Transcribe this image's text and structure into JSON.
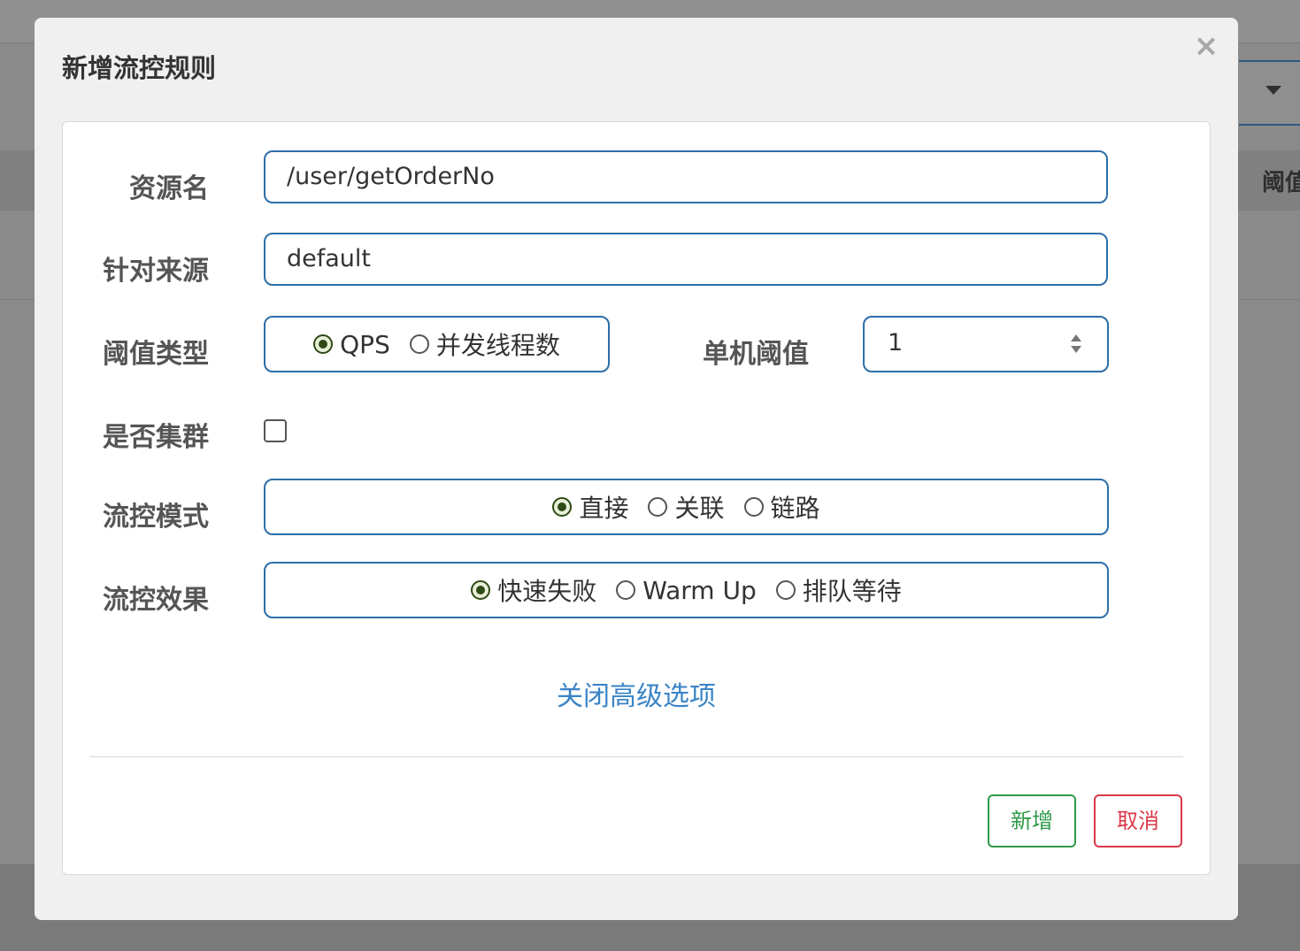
{
  "background": {
    "column_header_partial": "阈值"
  },
  "dialog": {
    "title": "新增流控规则",
    "close_symbol": "×",
    "fields": {
      "resource_label": "资源名",
      "resource_value": "/user/getOrderNo",
      "source_label": "针对来源",
      "source_value": "default",
      "threshold_type_label": "阈值类型",
      "threshold_type_options": [
        "QPS",
        "并发线程数"
      ],
      "threshold_type_selected": "QPS",
      "single_threshold_label": "单机阈值",
      "single_threshold_value": "1",
      "cluster_label": "是否集群",
      "cluster_checked": false,
      "mode_label": "流控模式",
      "mode_options": [
        "直接",
        "关联",
        "链路"
      ],
      "mode_selected": "直接",
      "effect_label": "流控效果",
      "effect_options": [
        "快速失败",
        "Warm Up",
        "排队等待"
      ],
      "effect_selected": "快速失败"
    },
    "advanced_link": "关闭高级选项",
    "buttons": {
      "add": "新增",
      "cancel": "取消"
    }
  },
  "colors": {
    "input_border": "#2d6ea8",
    "link": "#3a84c6",
    "add_button": "#2e9a48",
    "cancel_button": "#d9394a",
    "radio_checked": "#2e4a16"
  },
  "icons": {
    "close": "close-icon",
    "spinner": "number-spinner-icon",
    "dropdown": "caret-down-icon"
  }
}
